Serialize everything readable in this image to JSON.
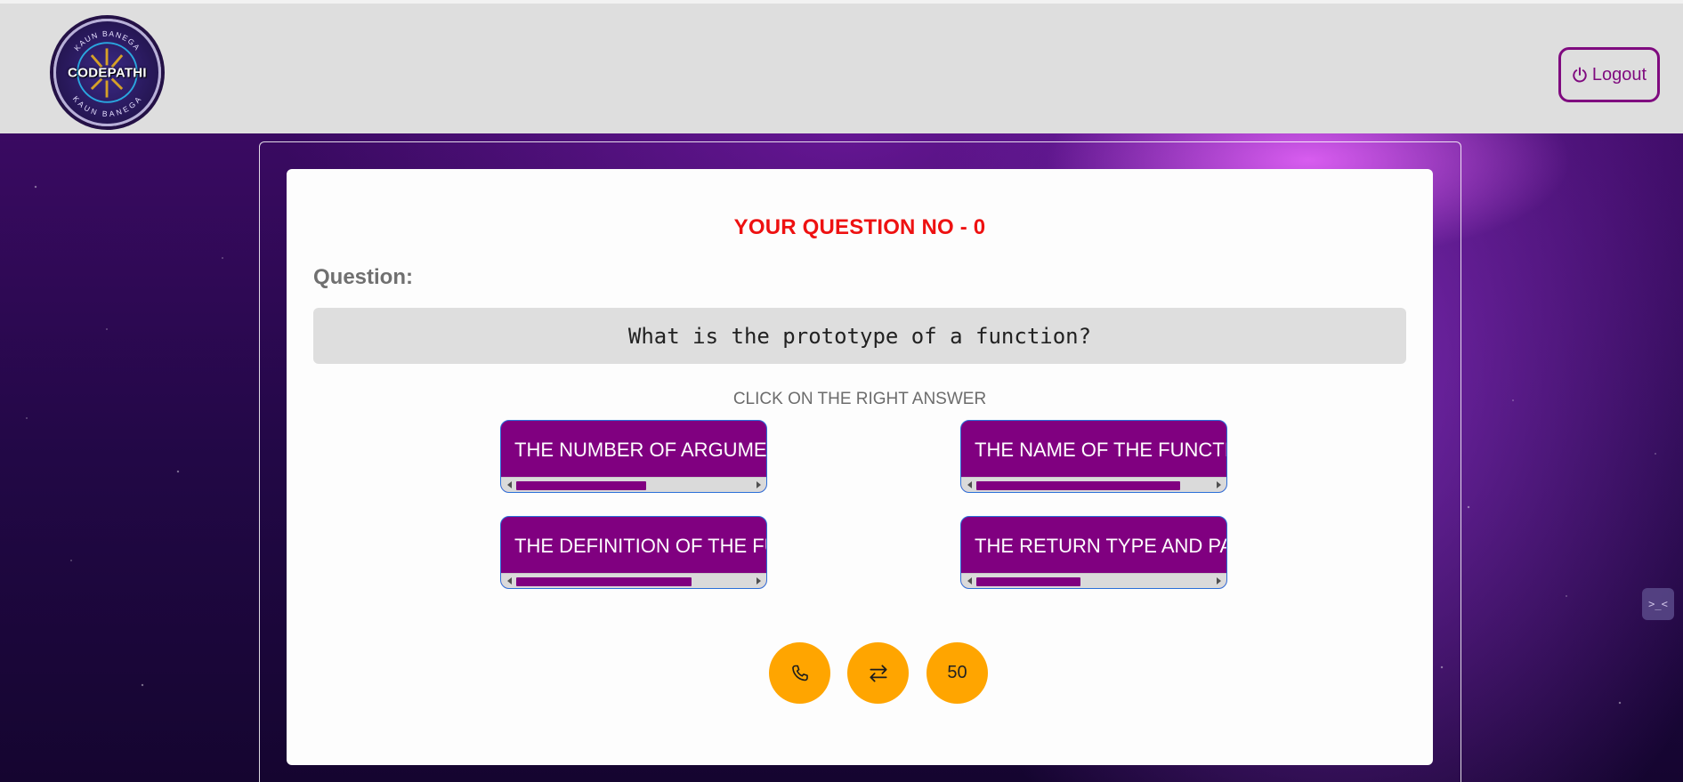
{
  "header": {
    "logo": {
      "ring_text_top": "KAUN BANEGA",
      "ring_text_bottom": "KAUN BANEGA",
      "center_text": "CODEPATHI"
    },
    "logout_label": "Logout"
  },
  "quiz": {
    "question_number_text": "YOUR QUESTION NO - 0",
    "question_label": "Question:",
    "question_text": "What is the prototype of a function?",
    "instruction": "CLICK ON THE RIGHT ANSWER",
    "options": [
      {
        "text": "THE NUMBER OF ARGUMENTS",
        "scroll_fraction": 0.55
      },
      {
        "text": "THE NAME OF THE FUNCTION",
        "scroll_fraction": 0.86
      },
      {
        "text": "THE DEFINITION OF THE FUNCTION",
        "scroll_fraction": 0.74
      },
      {
        "text": "THE RETURN TYPE AND PARAMETERS",
        "scroll_fraction": 0.44
      }
    ]
  },
  "lifelines": {
    "phone_icon": "phone-icon",
    "swap_icon": "swap-arrows-icon",
    "fifty_label": "50"
  },
  "colors": {
    "accent_purple": "#800080",
    "question_number_red": "#ee1111",
    "lifeline_orange": "#ffa500",
    "header_bg": "#dedede"
  }
}
